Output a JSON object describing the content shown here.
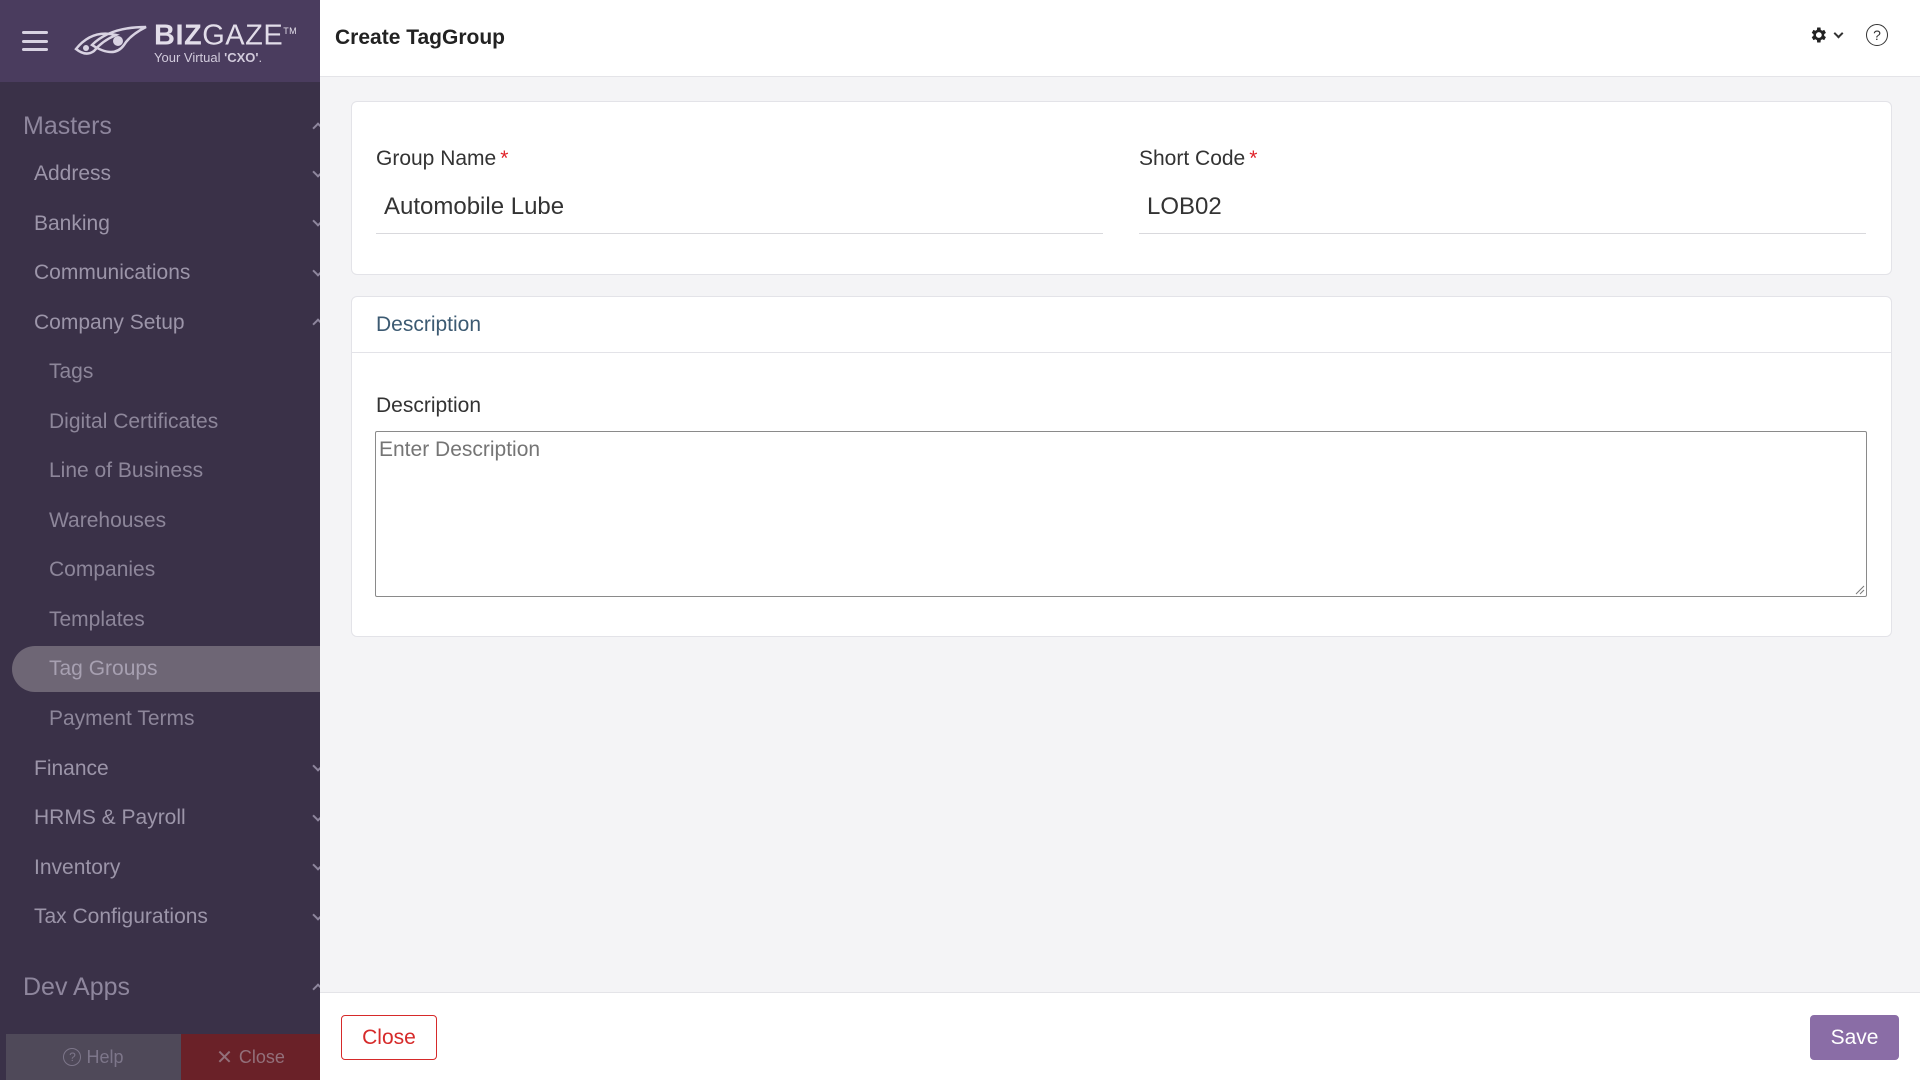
{
  "sidebar": {
    "brand": {
      "name_bold": "BIZ",
      "name_light": "GAZE",
      "trademark": "TM",
      "tagline_prefix": "Your Virtual ",
      "tagline_bold": "'CXO'",
      "tagline_suffix": "."
    },
    "sections": [
      {
        "title": "Masters",
        "groups": [
          {
            "label": "Address"
          },
          {
            "label": "Banking"
          },
          {
            "label": "Communications"
          },
          {
            "label": "Company Setup"
          }
        ],
        "company_setup_items": [
          {
            "label": "Tags"
          },
          {
            "label": "Digital Certificates"
          },
          {
            "label": "Line of Business"
          },
          {
            "label": "Warehouses"
          },
          {
            "label": "Companies"
          },
          {
            "label": "Templates"
          },
          {
            "label": "Tag Groups",
            "active": true
          },
          {
            "label": "Payment Terms"
          }
        ],
        "more_groups": [
          {
            "label": "Finance"
          },
          {
            "label": "HRMS & Payroll"
          },
          {
            "label": "Inventory"
          },
          {
            "label": "Tax Configurations"
          }
        ]
      },
      {
        "title": "Dev Apps"
      }
    ],
    "help_label": "Help",
    "close_label": "Close"
  },
  "header": {
    "title": "Create TagGroup",
    "settings_icon": "gear-icon",
    "help_icon": "question-circle-icon"
  },
  "form": {
    "group_name": {
      "label": "Group Name",
      "required_mark": "*",
      "value": "Automobile Lube"
    },
    "short_code": {
      "label": "Short Code",
      "required_mark": "*",
      "value": "LOB02"
    }
  },
  "description_section": {
    "header": "Description",
    "field_label": "Description",
    "placeholder": "Enter Description",
    "value": ""
  },
  "footer": {
    "close_label": "Close",
    "save_label": "Save"
  },
  "colors": {
    "sidebar_bg": "#3a3148",
    "brand_bg": "#4a3c5e",
    "accent": "#8a6da6",
    "danger": "#d62a2a",
    "required": "#e0242b"
  }
}
